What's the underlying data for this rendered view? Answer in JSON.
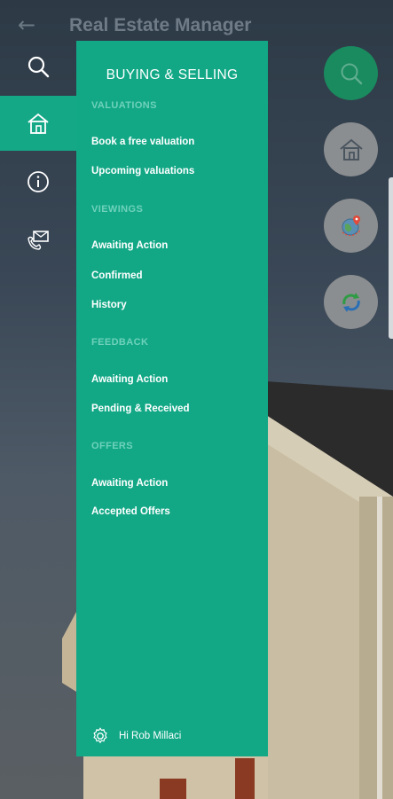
{
  "app": {
    "title": "Real Estate Manager"
  },
  "rail": {
    "items": [
      {
        "icon": "search-icon",
        "active": false
      },
      {
        "icon": "home-icon",
        "active": true
      },
      {
        "icon": "info-icon",
        "active": false
      },
      {
        "icon": "contact-icon",
        "active": false
      }
    ]
  },
  "drawer": {
    "title": "BUYING & SELLING",
    "sections": [
      {
        "header": "VALUATIONS",
        "items": [
          "Book a free valuation",
          "Upcoming valuations"
        ]
      },
      {
        "header": "VIEWINGS",
        "items": [
          "Awaiting Action",
          "Confirmed",
          "History"
        ]
      },
      {
        "header": "FEEDBACK",
        "items": [
          "Awaiting Action",
          "Pending & Received"
        ]
      },
      {
        "header": "OFFERS",
        "items": [
          "Awaiting Action",
          "Accepted Offers"
        ]
      }
    ],
    "footer": {
      "icon": "settings-icon",
      "text": "Hi Rob Millaci"
    }
  },
  "fabs": [
    {
      "icon": "search-icon"
    },
    {
      "icon": "home-icon"
    },
    {
      "icon": "globe-location-icon"
    },
    {
      "icon": "sync-icon"
    }
  ],
  "colors": {
    "accent": "#12a886",
    "primary_fab": "#1a8a5f",
    "secondary_fab": "#8b8e90",
    "section_header": "#6fd1bb"
  }
}
